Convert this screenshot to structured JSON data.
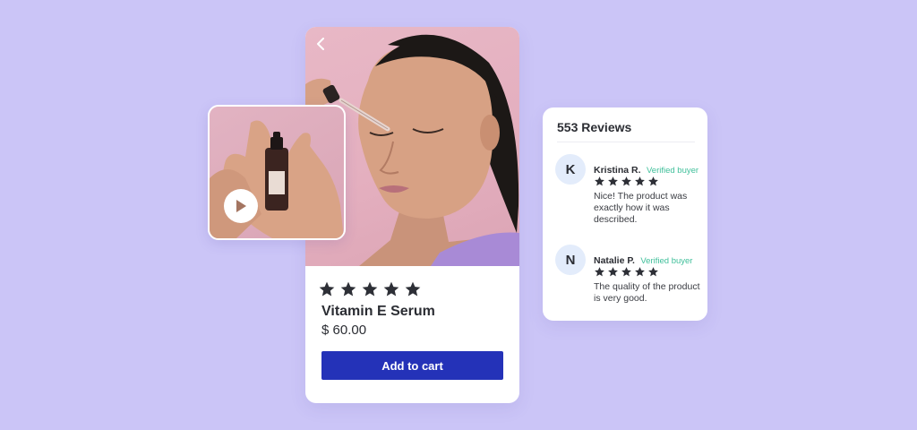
{
  "colors": {
    "background": "#cbc5f7",
    "cta": "#2432b8",
    "verified": "#3fbf9a",
    "star": "#2d2f36",
    "avatar_bg": "#e3ecfb"
  },
  "product": {
    "rating_stars": 5,
    "name": "Vitamin E Serum",
    "price": "$ 60.00",
    "cta_label": "Add to cart",
    "back_icon": "chevron-left-icon",
    "play_icon": "play-icon"
  },
  "reviews": {
    "title": "553 Reviews",
    "items": [
      {
        "initial": "K",
        "name": "Kristina R.",
        "badge": "Verified buyer",
        "stars": 5,
        "text": "Nice! The product was exactly how it was described."
      },
      {
        "initial": "N",
        "name": "Natalie P.",
        "badge": "Verified buyer",
        "stars": 5,
        "text": "The quality of the product is very good."
      }
    ]
  }
}
